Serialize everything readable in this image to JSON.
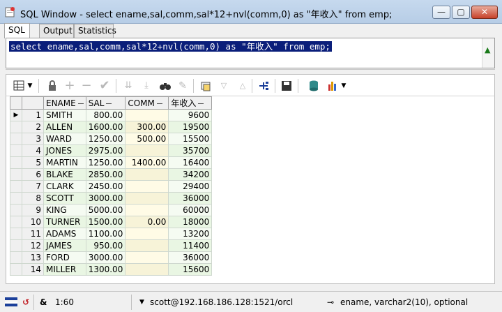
{
  "window": {
    "title": "SQL Window - select ename,sal,comm,sal*12+nvl(comm,0) as \"年收入\" from emp;",
    "minimize_label": "—",
    "maximize_label": "▢",
    "close_label": "✕"
  },
  "tabs": [
    {
      "label": "SQL"
    },
    {
      "label": "Output"
    },
    {
      "label": "Statistics"
    }
  ],
  "editor": {
    "sql_text": "select ename,sal,comm,sal*12+nvl(comm,0) as \"年收入\" from emp;"
  },
  "grid": {
    "columns": [
      "ENAME",
      "SAL",
      "COMM",
      "年收入"
    ],
    "rows": [
      {
        "num": "1",
        "ename": "SMITH",
        "sal": "800.00",
        "comm": "",
        "income": "9600"
      },
      {
        "num": "2",
        "ename": "ALLEN",
        "sal": "1600.00",
        "comm": "300.00",
        "income": "19500"
      },
      {
        "num": "3",
        "ename": "WARD",
        "sal": "1250.00",
        "comm": "500.00",
        "income": "15500"
      },
      {
        "num": "4",
        "ename": "JONES",
        "sal": "2975.00",
        "comm": "",
        "income": "35700"
      },
      {
        "num": "5",
        "ename": "MARTIN",
        "sal": "1250.00",
        "comm": "1400.00",
        "income": "16400"
      },
      {
        "num": "6",
        "ename": "BLAKE",
        "sal": "2850.00",
        "comm": "",
        "income": "34200"
      },
      {
        "num": "7",
        "ename": "CLARK",
        "sal": "2450.00",
        "comm": "",
        "income": "29400"
      },
      {
        "num": "8",
        "ename": "SCOTT",
        "sal": "3000.00",
        "comm": "",
        "income": "36000"
      },
      {
        "num": "9",
        "ename": "KING",
        "sal": "5000.00",
        "comm": "",
        "income": "60000"
      },
      {
        "num": "10",
        "ename": "TURNER",
        "sal": "1500.00",
        "comm": "0.00",
        "income": "18000"
      },
      {
        "num": "11",
        "ename": "ADAMS",
        "sal": "1100.00",
        "comm": "",
        "income": "13200"
      },
      {
        "num": "12",
        "ename": "JAMES",
        "sal": "950.00",
        "comm": "",
        "income": "11400"
      },
      {
        "num": "13",
        "ename": "FORD",
        "sal": "3000.00",
        "comm": "",
        "income": "36000"
      },
      {
        "num": "14",
        "ename": "MILLER",
        "sal": "1300.00",
        "comm": "",
        "income": "15600"
      }
    ]
  },
  "status": {
    "ampersand": "&",
    "position": "1:60",
    "connection": "scott@192.168.186.128:1521/orcl",
    "field_info": "ename, varchar2(10), optional"
  },
  "colors": {
    "selection_bg": "#0a1e7a",
    "grid_row_odd": "#f5fbf2",
    "grid_row_even": "#e9f6e3",
    "comm_column": "#fffbe6"
  },
  "icons": {
    "window": "sql-window-icon",
    "scroll_up": "green-up-arrow-icon"
  }
}
